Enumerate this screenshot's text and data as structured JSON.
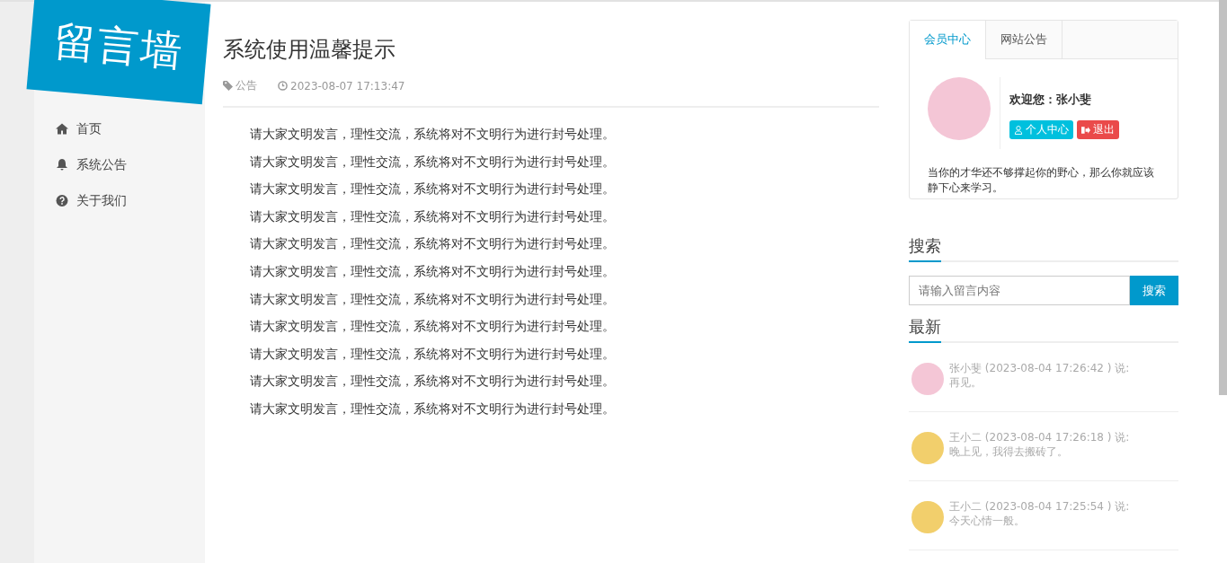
{
  "logo": {
    "text": "留言墙"
  },
  "nav": [
    {
      "kind": "home",
      "label": "首页"
    },
    {
      "kind": "bell",
      "label": "系统公告"
    },
    {
      "kind": "question",
      "label": "关于我们"
    }
  ],
  "article": {
    "title": "系统使用温馨提示",
    "category": "公告",
    "date": "2023-08-07 17:13:47",
    "paragraphs": [
      "请大家文明发言，理性交流，系统将对不文明行为进行封号处理。",
      "请大家文明发言，理性交流，系统将对不文明行为进行封号处理。",
      "请大家文明发言，理性交流，系统将对不文明行为进行封号处理。",
      "请大家文明发言，理性交流，系统将对不文明行为进行封号处理。",
      "请大家文明发言，理性交流，系统将对不文明行为进行封号处理。",
      "请大家文明发言，理性交流，系统将对不文明行为进行封号处理。",
      "请大家文明发言，理性交流，系统将对不文明行为进行封号处理。",
      "请大家文明发言，理性交流，系统将对不文明行为进行封号处理。",
      "请大家文明发言，理性交流，系统将对不文明行为进行封号处理。",
      "请大家文明发言，理性交流，系统将对不文明行为进行封号处理。",
      "请大家文明发言，理性交流，系统将对不文明行为进行封号处理。"
    ]
  },
  "member_card": {
    "tabs": [
      {
        "label": "会员中心",
        "selected": true
      },
      {
        "label": "网站公告",
        "selected": false
      }
    ],
    "welcome": "欢迎您：张小斐",
    "profile_button": "个人中心",
    "logout_button": "退出",
    "motto": "当你的才华还不够撑起你的野心，那么你就应该静下心来学习。"
  },
  "search": {
    "heading": "搜索",
    "placeholder": "请输入留言内容",
    "button": "搜索"
  },
  "latest": {
    "heading": "最新",
    "messages": [
      {
        "author": "张小斐",
        "time": "(2023-08-04 17:26:42 ) 说:",
        "text": "再见。",
        "color": "#f4c6d6"
      },
      {
        "author": "王小二",
        "time": "(2023-08-04 17:26:18 ) 说:",
        "text": "晚上见，我得去搬砖了。",
        "color": "#f2cf6c"
      },
      {
        "author": "王小二",
        "time": "(2023-08-04 17:25:54 ) 说:",
        "text": "今天心情一般。",
        "color": "#f2cf6c"
      }
    ]
  }
}
